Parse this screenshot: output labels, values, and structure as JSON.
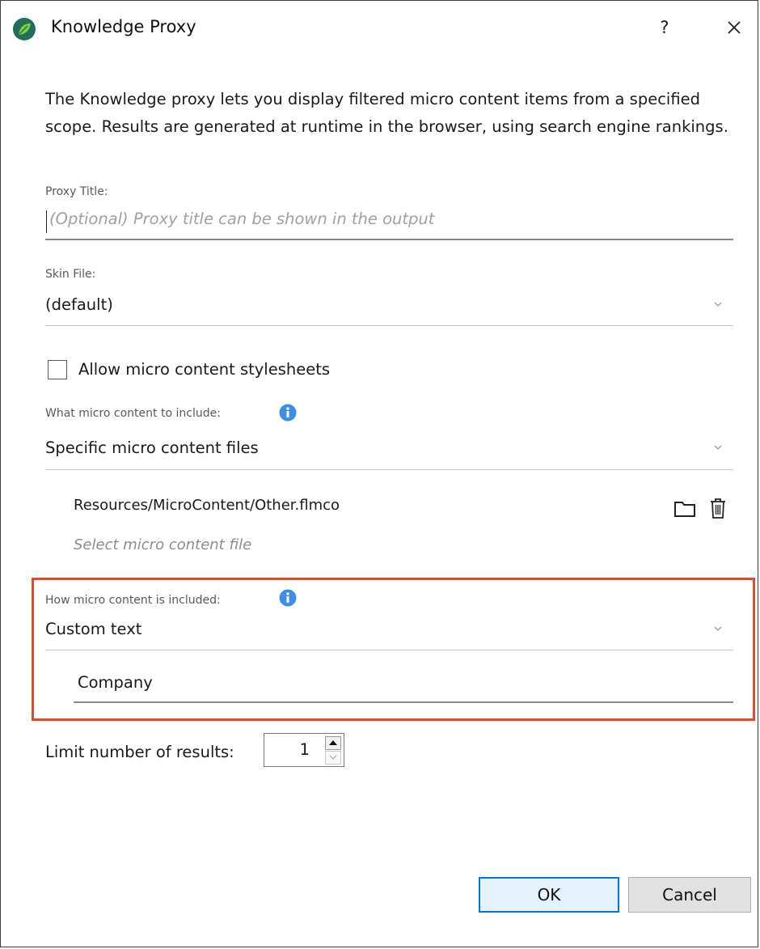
{
  "window": {
    "title": "Knowledge Proxy",
    "help_label": "?",
    "icon": "app-leaf-icon",
    "close_icon": "close-icon"
  },
  "description": "The Knowledge proxy lets you display filtered micro content items from a specified scope. Results are generated at runtime in the browser, using search engine rankings.",
  "proxy_title": {
    "label": "Proxy Title:",
    "placeholder": "(Optional) Proxy title can be shown in the output",
    "value": ""
  },
  "skin_file": {
    "label": "Skin File:",
    "value": "(default)"
  },
  "allow_stylesheets": {
    "label": "Allow micro content stylesheets",
    "checked": false
  },
  "what_to_include": {
    "label": "What micro content to include:",
    "value": "Specific micro content files",
    "files": [
      {
        "path": "Resources/MicroContent/Other.flmco"
      }
    ],
    "add_placeholder": "Select micro content file"
  },
  "how_included": {
    "label": "How micro content is included:",
    "value": "Custom text",
    "custom_text": "Company"
  },
  "limit": {
    "label": "Limit number of results:",
    "value": "1"
  },
  "buttons": {
    "ok": "OK",
    "cancel": "Cancel"
  },
  "colors": {
    "highlight_border": "#e2492b",
    "info_icon": "#3d8ee8",
    "ok_border": "#0078d7"
  }
}
